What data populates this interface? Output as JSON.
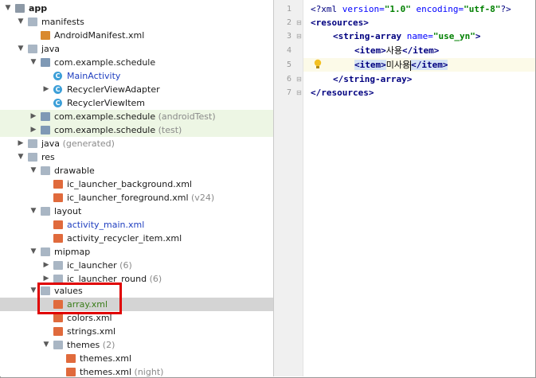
{
  "project_tree": {
    "root": "app",
    "manifests": {
      "label": "manifests",
      "file": "AndroidManifest.xml"
    },
    "java": {
      "label": "java",
      "pkg_main": "com.example.schedule",
      "classes": [
        "MainActivity",
        "RecyclerViewAdapter",
        "RecyclerViewItem"
      ],
      "pkg_android_test": "com.example.schedule",
      "pkg_android_test_suffix": "(androidTest)",
      "pkg_test": "com.example.schedule",
      "pkg_test_suffix": "(test)"
    },
    "java_generated": {
      "label": "java",
      "suffix": "(generated)"
    },
    "res": {
      "label": "res",
      "drawable": {
        "label": "drawable",
        "files": [
          "ic_launcher_background.xml",
          "ic_launcher_foreground.xml"
        ],
        "file2_suffix": "(v24)"
      },
      "layout": {
        "label": "layout",
        "files": [
          "activity_main.xml",
          "activity_recycler_item.xml"
        ]
      },
      "mipmap": {
        "label": "mipmap",
        "items": [
          "ic_launcher",
          "ic_launcher_round"
        ],
        "suffixes": [
          "(6)",
          "(6)"
        ]
      },
      "values": {
        "label": "values",
        "files": [
          "array.xml",
          "colors.xml",
          "strings.xml"
        ]
      },
      "themes": {
        "label": "themes",
        "suffix": "(2)",
        "files": [
          "themes.xml",
          "themes.xml"
        ],
        "file2_suffix": "(night)"
      }
    }
  },
  "editor": {
    "line_numbers": [
      "1",
      "2",
      "3",
      "4",
      "5",
      "6",
      "7"
    ],
    "lines": {
      "l1": {
        "decl_open": "<?",
        "decl_name": "xml",
        "attr1": " version=",
        "val1": "\"1.0\"",
        "attr2": " encoding=",
        "val2": "\"utf-8\"",
        "decl_close": "?>"
      },
      "l2": {
        "tag": "<resources>"
      },
      "l3": {
        "tag_open": "<string-array",
        "attr": " name=",
        "val": "\"use_yn\"",
        "tag_close": ">"
      },
      "l4": {
        "open": "<item>",
        "text": "사용",
        "close": "</item>"
      },
      "l5": {
        "open": "<item>",
        "text": "미사용",
        "close": "</item>"
      },
      "l6": {
        "tag": "</string-array>"
      },
      "l7": {
        "tag": "</resources>"
      }
    }
  }
}
